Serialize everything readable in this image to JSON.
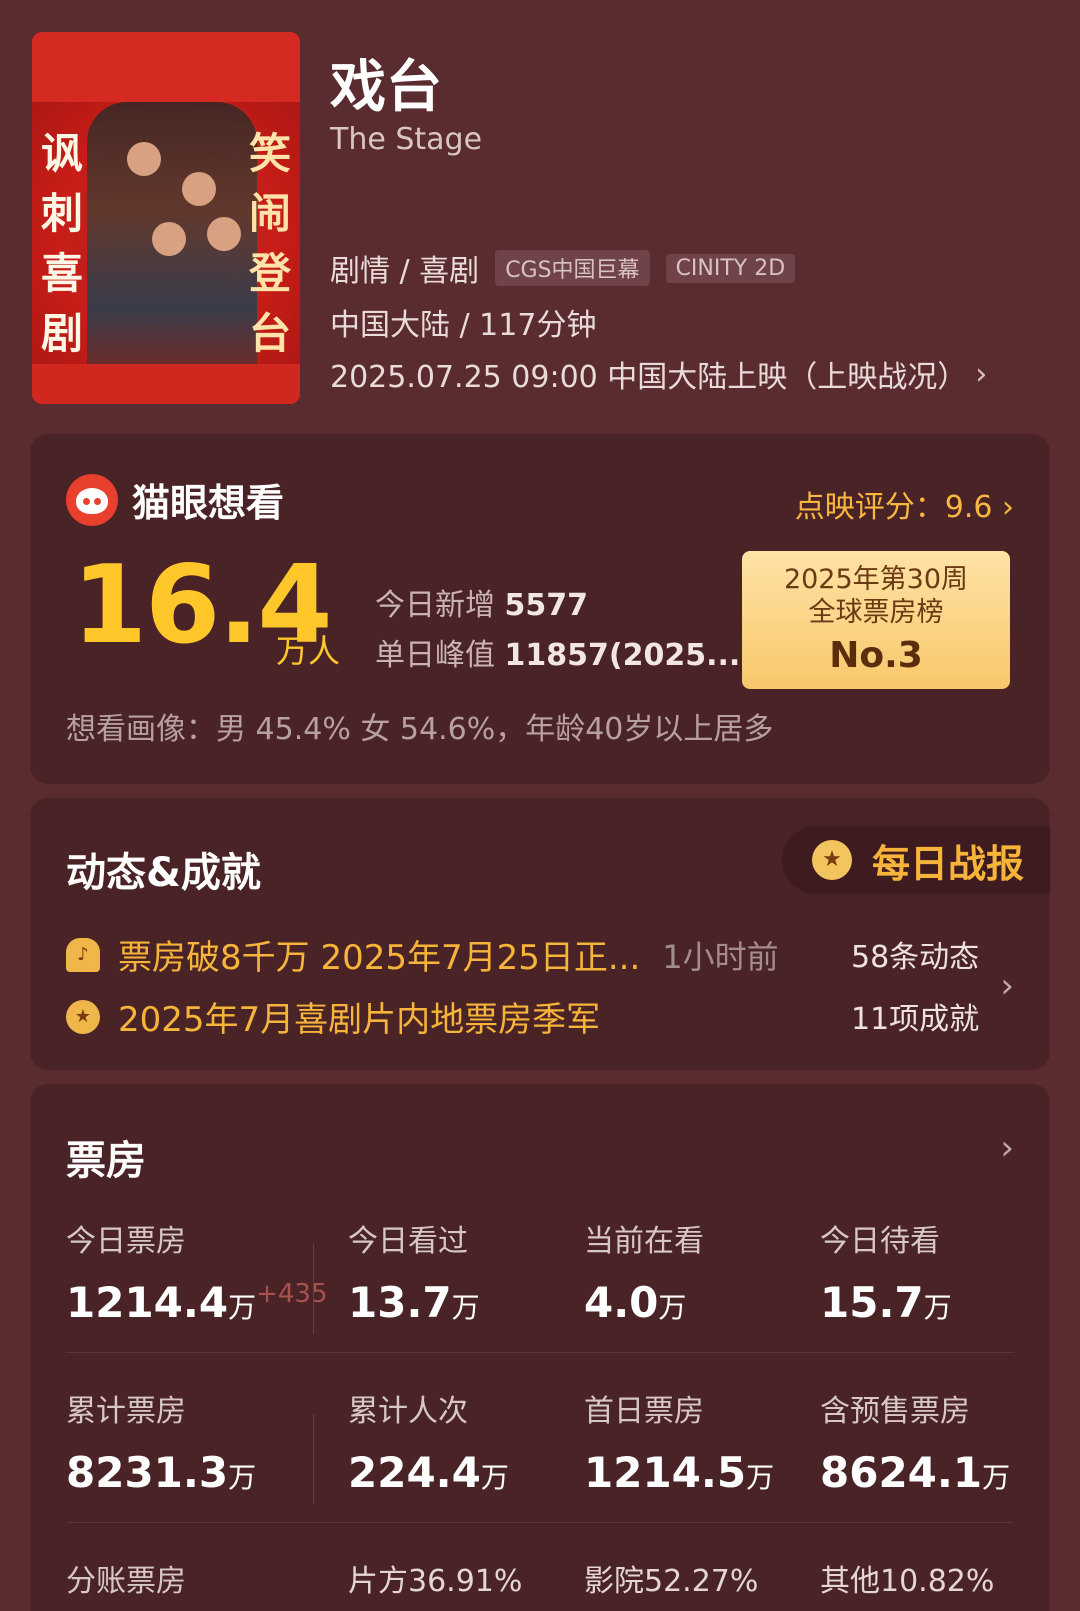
{
  "movie": {
    "title": "戏台",
    "english_title": "The Stage",
    "genres": "剧情 / 喜剧",
    "tags": [
      "CGS中国巨幕",
      "CINITY 2D"
    ],
    "region_runtime": "中国大陆 / 117分钟",
    "release": "2025.07.25 09:00 中国大陆上映（上映战况）",
    "poster": {
      "left_text": "讽刺喜剧",
      "right_text": "笑闹登台"
    }
  },
  "wish": {
    "brand": "猫眼想看",
    "preview_score": "点映评分：9.6",
    "total": "16.4",
    "total_unit": "万人",
    "today_new_label": "今日新增",
    "today_new_value": "5577",
    "peak_label": "单日峰值",
    "peak_value": "11857(2025....",
    "rank_line1": "2025年第30周",
    "rank_line2": "全球票房榜",
    "rank_line3": "No.3",
    "portrait": "想看画像：男 45.4%  女 54.6%，年龄40岁以上居多"
  },
  "dynamics": {
    "title": "动态&成就",
    "daily_report": "每日战报",
    "item1_text": "票房破8千万 2025年7月25日正...",
    "item1_time": "1小时前",
    "item1_count": "58条动态",
    "item2_text": "2025年7月喜剧片内地票房季军",
    "item2_count": "11项成就"
  },
  "box_office": {
    "title": "票房",
    "row1": [
      {
        "label": "今日票房",
        "value": "1214.4",
        "unit": "万",
        "inc": "+435"
      },
      {
        "label": "今日看过",
        "value": "13.7",
        "unit": "万"
      },
      {
        "label": "当前在看",
        "value": "4.0",
        "unit": "万"
      },
      {
        "label": "今日待看",
        "value": "15.7",
        "unit": "万"
      }
    ],
    "row2": [
      {
        "label": "累计票房",
        "value": "8231.3",
        "unit": "万"
      },
      {
        "label": "累计人次",
        "value": "224.4",
        "unit": "万"
      },
      {
        "label": "首日票房",
        "value": "1214.5",
        "unit": "万"
      },
      {
        "label": "含预售票房",
        "value": "8624.1",
        "unit": "万"
      }
    ],
    "split_label": "分账票房",
    "split": [
      "片方36.91%",
      "影院52.27%",
      "其他10.82%"
    ]
  },
  "colors": {
    "background": "#5a2b2f",
    "card": "#4a2326",
    "accent_gold": "#ffc72a",
    "accent_orange": "#f6b43a"
  },
  "icons": [
    "maoyan-cat-icon",
    "chevron-right-icon",
    "bell-icon",
    "medal-icon"
  ]
}
